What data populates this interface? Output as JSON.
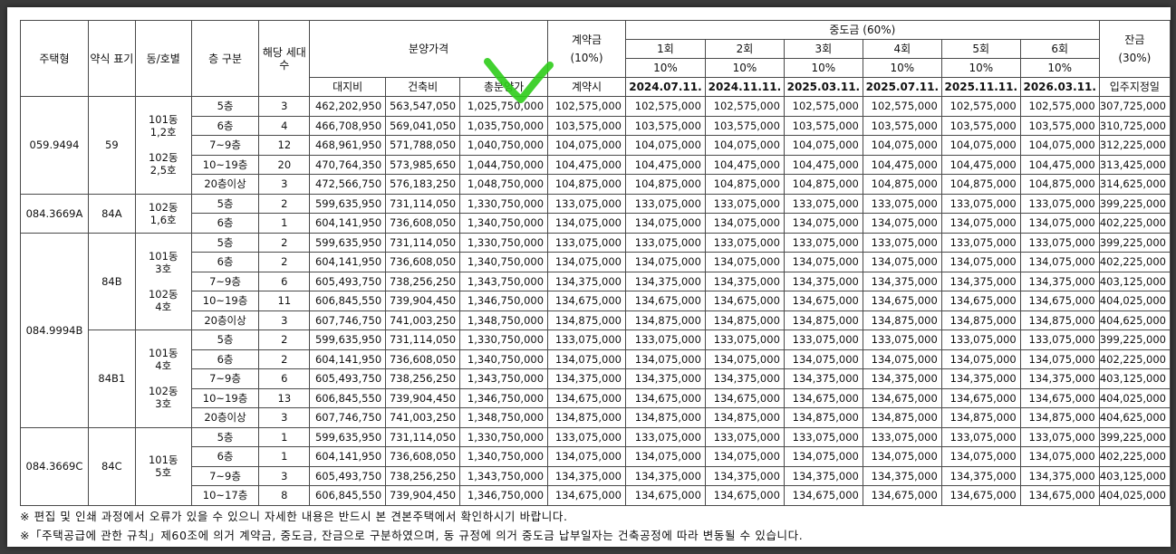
{
  "headers": {
    "type": "주택형",
    "abbr": "약식\n표기",
    "unit": "동/호별",
    "floor": "층 구분",
    "count": "해당\n세대수",
    "price": "분양가격",
    "land": "대지비",
    "building": "건축비",
    "total": "총분양가",
    "deposit": "계약금",
    "deposit_pct": "(10%)",
    "deposit_when": "계약시",
    "mid": "중도금 (60%)",
    "balance": "잔금",
    "balance_pct": "(30%)",
    "balance_when": "입주지정일"
  },
  "installments": [
    {
      "label": "1회",
      "pct": "10%",
      "date": "2024.07.11."
    },
    {
      "label": "2회",
      "pct": "10%",
      "date": "2024.11.11."
    },
    {
      "label": "3회",
      "pct": "10%",
      "date": "2025.03.11."
    },
    {
      "label": "4회",
      "pct": "10%",
      "date": "2025.07.11."
    },
    {
      "label": "5회",
      "pct": "10%",
      "date": "2025.11.11."
    },
    {
      "label": "6회",
      "pct": "10%",
      "date": "2026.03.11."
    }
  ],
  "groups": [
    {
      "type": "059.9494",
      "subs": [
        {
          "abbr": "59",
          "units": [
            "101동\n1,2호",
            "102동\n2,5호"
          ],
          "rows": [
            {
              "floor": "5층",
              "count": "3",
              "land": "462,202,950",
              "building": "563,547,050",
              "total": "1,025,750,000",
              "deposit": "102,575,000",
              "mid": "102,575,000",
              "balance": "307,725,000"
            },
            {
              "floor": "6층",
              "count": "4",
              "land": "466,708,950",
              "building": "569,041,050",
              "total": "1,035,750,000",
              "deposit": "103,575,000",
              "mid": "103,575,000",
              "balance": "310,725,000"
            },
            {
              "floor": "7~9층",
              "count": "12",
              "land": "468,961,950",
              "building": "571,788,050",
              "total": "1,040,750,000",
              "deposit": "104,075,000",
              "mid": "104,075,000",
              "balance": "312,225,000"
            },
            {
              "floor": "10~19층",
              "count": "20",
              "land": "470,764,350",
              "building": "573,985,650",
              "total": "1,044,750,000",
              "deposit": "104,475,000",
              "mid": "104,475,000",
              "balance": "313,425,000"
            },
            {
              "floor": "20층이상",
              "count": "3",
              "land": "472,566,750",
              "building": "576,183,250",
              "total": "1,048,750,000",
              "deposit": "104,875,000",
              "mid": "104,875,000",
              "balance": "314,625,000"
            }
          ]
        }
      ]
    },
    {
      "type": "084.3669A",
      "subs": [
        {
          "abbr": "84A",
          "units": [
            "102동\n1,6호"
          ],
          "rows": [
            {
              "floor": "5층",
              "count": "2",
              "land": "599,635,950",
              "building": "731,114,050",
              "total": "1,330,750,000",
              "deposit": "133,075,000",
              "mid": "133,075,000",
              "balance": "399,225,000"
            },
            {
              "floor": "6층",
              "count": "1",
              "land": "604,141,950",
              "building": "736,608,050",
              "total": "1,340,750,000",
              "deposit": "134,075,000",
              "mid": "134,075,000",
              "balance": "402,225,000"
            }
          ]
        }
      ]
    },
    {
      "type": "084.9994B",
      "subs": [
        {
          "abbr": "84B",
          "units": [
            "101동\n3호",
            "102동\n4호"
          ],
          "rows": [
            {
              "floor": "5층",
              "count": "2",
              "land": "599,635,950",
              "building": "731,114,050",
              "total": "1,330,750,000",
              "deposit": "133,075,000",
              "mid": "133,075,000",
              "balance": "399,225,000"
            },
            {
              "floor": "6층",
              "count": "2",
              "land": "604,141,950",
              "building": "736,608,050",
              "total": "1,340,750,000",
              "deposit": "134,075,000",
              "mid": "134,075,000",
              "balance": "402,225,000"
            },
            {
              "floor": "7~9층",
              "count": "6",
              "land": "605,493,750",
              "building": "738,256,250",
              "total": "1,343,750,000",
              "deposit": "134,375,000",
              "mid": "134,375,000",
              "balance": "403,125,000"
            },
            {
              "floor": "10~19층",
              "count": "11",
              "land": "606,845,550",
              "building": "739,904,450",
              "total": "1,346,750,000",
              "deposit": "134,675,000",
              "mid": "134,675,000",
              "balance": "404,025,000"
            },
            {
              "floor": "20층이상",
              "count": "3",
              "land": "607,746,750",
              "building": "741,003,250",
              "total": "1,348,750,000",
              "deposit": "134,875,000",
              "mid": "134,875,000",
              "balance": "404,625,000"
            }
          ]
        },
        {
          "abbr": "84B1",
          "units": [
            "101동\n4호",
            "102동\n3호"
          ],
          "rows": [
            {
              "floor": "5층",
              "count": "2",
              "land": "599,635,950",
              "building": "731,114,050",
              "total": "1,330,750,000",
              "deposit": "133,075,000",
              "mid": "133,075,000",
              "balance": "399,225,000"
            },
            {
              "floor": "6층",
              "count": "2",
              "land": "604,141,950",
              "building": "736,608,050",
              "total": "1,340,750,000",
              "deposit": "134,075,000",
              "mid": "134,075,000",
              "balance": "402,225,000"
            },
            {
              "floor": "7~9층",
              "count": "6",
              "land": "605,493,750",
              "building": "738,256,250",
              "total": "1,343,750,000",
              "deposit": "134,375,000",
              "mid": "134,375,000",
              "balance": "403,125,000"
            },
            {
              "floor": "10~19층",
              "count": "13",
              "land": "606,845,550",
              "building": "739,904,450",
              "total": "1,346,750,000",
              "deposit": "134,675,000",
              "mid": "134,675,000",
              "balance": "404,025,000"
            },
            {
              "floor": "20층이상",
              "count": "3",
              "land": "607,746,750",
              "building": "741,003,250",
              "total": "1,348,750,000",
              "deposit": "134,875,000",
              "mid": "134,875,000",
              "balance": "404,625,000"
            }
          ]
        }
      ]
    },
    {
      "type": "084.3669C",
      "subs": [
        {
          "abbr": "84C",
          "units": [
            "101동\n5호"
          ],
          "rows": [
            {
              "floor": "5층",
              "count": "1",
              "land": "599,635,950",
              "building": "731,114,050",
              "total": "1,330,750,000",
              "deposit": "133,075,000",
              "mid": "133,075,000",
              "balance": "399,225,000"
            },
            {
              "floor": "6층",
              "count": "1",
              "land": "604,141,950",
              "building": "736,608,050",
              "total": "1,340,750,000",
              "deposit": "134,075,000",
              "mid": "134,075,000",
              "balance": "402,225,000"
            },
            {
              "floor": "7~9층",
              "count": "3",
              "land": "605,493,750",
              "building": "738,256,250",
              "total": "1,343,750,000",
              "deposit": "134,375,000",
              "mid": "134,375,000",
              "balance": "403,125,000"
            },
            {
              "floor": "10~17층",
              "count": "8",
              "land": "606,845,550",
              "building": "739,904,450",
              "total": "1,346,750,000",
              "deposit": "134,675,000",
              "mid": "134,675,000",
              "balance": "404,025,000"
            }
          ]
        }
      ]
    }
  ],
  "notes": [
    "※ 편집 및 인쇄 과정에서 오류가 있을 수 있으니 자세한 내용은 반드시 본 견본주택에서 확인하시기 바랍니다.",
    "※「주택공급에 관한 규칙」제60조에 의거 계약금, 중도금, 잔금으로 구분하였으며, 동 규정에 의거 중도금 납부일자는 건축공정에 따라 변동될 수 있습니다."
  ],
  "colors": {
    "background": "#3b3b3b",
    "paper": "#ffffff",
    "checkmark": "#2ecc1a"
  }
}
